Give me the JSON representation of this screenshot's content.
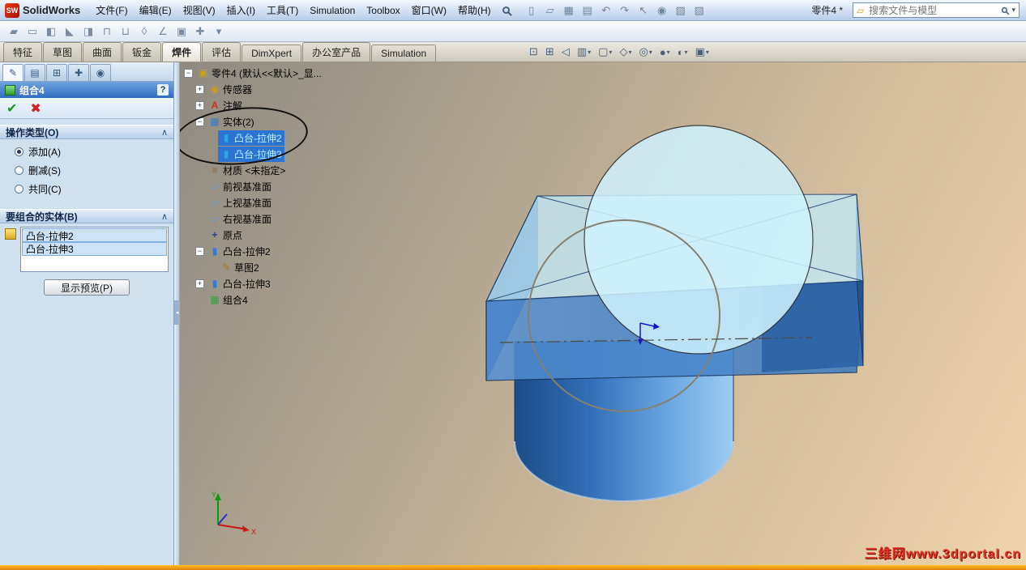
{
  "window": {
    "app_name": "SolidWorks",
    "logo_badge": "SW",
    "doc_title": "零件4 *",
    "search_placeholder": "搜索文件与模型"
  },
  "menu_bar": {
    "items": [
      "文件(F)",
      "编辑(E)",
      "视图(V)",
      "插入(I)",
      "工具(T)",
      "Simulation",
      "Toolbox",
      "窗口(W)",
      "帮助(H)"
    ]
  },
  "title_toolbar": {
    "icons": [
      {
        "name": "new-document-icon",
        "glyph": "▯"
      },
      {
        "name": "open-icon",
        "glyph": "▱"
      },
      {
        "name": "save-icon",
        "glyph": "▦"
      },
      {
        "name": "print-icon",
        "glyph": "▤"
      },
      {
        "name": "undo-icon",
        "glyph": "↶"
      },
      {
        "name": "redo-icon",
        "glyph": "↷"
      },
      {
        "name": "select-icon",
        "glyph": "↖"
      },
      {
        "name": "rebuild-icon",
        "glyph": "◉"
      },
      {
        "name": "file-properties-icon",
        "glyph": "▧"
      },
      {
        "name": "options-icon",
        "glyph": "▨"
      }
    ]
  },
  "toolbar2": {
    "icons": [
      {
        "name": "structural-member-icon",
        "glyph": "▰"
      },
      {
        "name": "trim-extend-icon",
        "glyph": "▭"
      },
      {
        "name": "end-cap-icon",
        "glyph": "◧"
      },
      {
        "name": "gusset-icon",
        "glyph": "◣"
      },
      {
        "name": "weld-bead-icon",
        "glyph": "◨"
      },
      {
        "name": "extruded-boss-icon",
        "glyph": "⊓"
      },
      {
        "name": "extruded-cut-icon",
        "glyph": "⊔"
      },
      {
        "name": "hole-wizard-icon",
        "glyph": "◊"
      },
      {
        "name": "fillet-icon",
        "glyph": "∠"
      },
      {
        "name": "chamfer-icon",
        "glyph": "▣"
      },
      {
        "name": "reference-geometry-icon",
        "glyph": "✚"
      },
      {
        "name": "toolbar-dropdown-caret",
        "glyph": "▾"
      }
    ]
  },
  "ribbon": {
    "tabs": [
      {
        "label": "特征",
        "active": false
      },
      {
        "label": "草图",
        "active": false
      },
      {
        "label": "曲面",
        "active": false
      },
      {
        "label": "钣金",
        "active": false
      },
      {
        "label": "焊件",
        "active": true
      },
      {
        "label": "评估",
        "active": false
      },
      {
        "label": "DimXpert",
        "active": false
      },
      {
        "label": "办公室产品",
        "active": false
      },
      {
        "label": "Simulation",
        "active": false
      }
    ]
  },
  "headsup": {
    "icons": [
      {
        "name": "zoom-fit-icon",
        "glyph": "⊡",
        "dropdown": false
      },
      {
        "name": "zoom-area-icon",
        "glyph": "⊞",
        "dropdown": false
      },
      {
        "name": "previous-view-icon",
        "glyph": "◁",
        "dropdown": false
      },
      {
        "name": "section-view-icon",
        "glyph": "▥",
        "dropdown": true
      },
      {
        "name": "view-orientation-icon",
        "glyph": "▢",
        "dropdown": true
      },
      {
        "name": "display-style-icon",
        "glyph": "◇",
        "dropdown": true
      },
      {
        "name": "hide-show-items-icon",
        "glyph": "◎",
        "dropdown": true
      },
      {
        "name": "edit-appearance-icon",
        "glyph": "●",
        "dropdown": true
      },
      {
        "name": "apply-scene-icon",
        "glyph": "◐",
        "dropdown": true
      },
      {
        "name": "view-settings-icon",
        "glyph": "▣",
        "dropdown": true
      }
    ]
  },
  "property_manager": {
    "tabs": [
      {
        "name": "propertymanager-tab",
        "glyph": "✎",
        "active": true
      },
      {
        "name": "configurations-tab",
        "glyph": "▤",
        "active": false
      },
      {
        "name": "dimxpert-manager-tab",
        "glyph": "⊞",
        "active": false
      },
      {
        "name": "displaymanager-tab",
        "glyph": "✚",
        "active": false
      },
      {
        "name": "appearances-tab",
        "glyph": "◉",
        "active": false
      }
    ],
    "title": "组合4",
    "help_label": "?",
    "ok_icon": "✔",
    "cancel_icon": "✖",
    "operation_section": {
      "title": "操作类型(O)",
      "collapse_icon": "∧",
      "radios": [
        {
          "name": "add",
          "label": "添加(A)",
          "selected": true
        },
        {
          "name": "subtract",
          "label": "删减(S)",
          "selected": false
        },
        {
          "name": "common",
          "label": "共同(C)",
          "selected": false
        }
      ]
    },
    "bodies_section": {
      "title": "要组合的实体(B)",
      "collapse_icon": "∧",
      "items": [
        "凸台-拉伸2",
        "凸台-拉伸3"
      ],
      "preview_button": "显示预览(P)"
    }
  },
  "feature_tree": {
    "items": [
      {
        "label": "零件4 (默认<<默认>_显...",
        "depth": 0,
        "expand": "minus",
        "icon": "part-icon",
        "glyph": "▣",
        "color": "#c8a020",
        "selected": false
      },
      {
        "label": "传感器",
        "depth": 1,
        "expand": "plus",
        "icon": "sensors-icon",
        "glyph": "◉",
        "color": "#c8a020",
        "selected": false
      },
      {
        "label": "注解",
        "depth": 1,
        "expand": "plus",
        "icon": "annotations-icon",
        "glyph": "A",
        "color": "#d03020",
        "selected": false
      },
      {
        "label": "实体(2)",
        "depth": 1,
        "expand": "minus",
        "icon": "solid-bodies-folder-icon",
        "glyph": "▦",
        "color": "#3a7cc8",
        "selected": false
      },
      {
        "label": "凸台-拉伸2",
        "depth": 2,
        "expand": null,
        "icon": "solid-body-icon",
        "glyph": "▮",
        "color": "#28a8e0",
        "selected": true
      },
      {
        "label": "凸台-拉伸3",
        "depth": 2,
        "expand": null,
        "icon": "solid-body-icon",
        "glyph": "▮",
        "color": "#28a8e0",
        "selected": true
      },
      {
        "label": "材质 <未指定>",
        "depth": 1,
        "expand": null,
        "icon": "material-icon",
        "glyph": "≡",
        "color": "#8a6a40",
        "selected": false
      },
      {
        "label": "前视基准面",
        "depth": 1,
        "expand": null,
        "icon": "plane-icon",
        "glyph": "▱",
        "color": "#6a94c8",
        "selected": false
      },
      {
        "label": "上视基准面",
        "depth": 1,
        "expand": null,
        "icon": "plane-icon",
        "glyph": "▱",
        "color": "#6a94c8",
        "selected": false
      },
      {
        "label": "右视基准面",
        "depth": 1,
        "expand": null,
        "icon": "plane-icon",
        "glyph": "▱",
        "color": "#6a94c8",
        "selected": false
      },
      {
        "label": "原点",
        "depth": 1,
        "expand": null,
        "icon": "origin-icon",
        "glyph": "+",
        "color": "#2040a0",
        "selected": false
      },
      {
        "label": "凸台-拉伸2",
        "depth": 1,
        "expand": "minus",
        "icon": "boss-extrude-icon",
        "glyph": "▮",
        "color": "#2f7de0",
        "selected": false
      },
      {
        "label": "草图2",
        "depth": 2,
        "expand": null,
        "icon": "sketch-icon",
        "glyph": "✎",
        "color": "#b07020",
        "selected": false
      },
      {
        "label": "凸台-拉伸3",
        "depth": 1,
        "expand": "plus",
        "icon": "boss-extrude-icon",
        "glyph": "▮",
        "color": "#2f7de0",
        "selected": false
      },
      {
        "label": "组合4",
        "depth": 1,
        "expand": null,
        "icon": "combine-icon",
        "glyph": "▦",
        "color": "#30a040",
        "selected": false
      }
    ]
  },
  "viewport": {
    "watermark": "三维网www.3dportal.cn",
    "triad": {
      "x_label": "X",
      "y_label": "Y"
    }
  }
}
